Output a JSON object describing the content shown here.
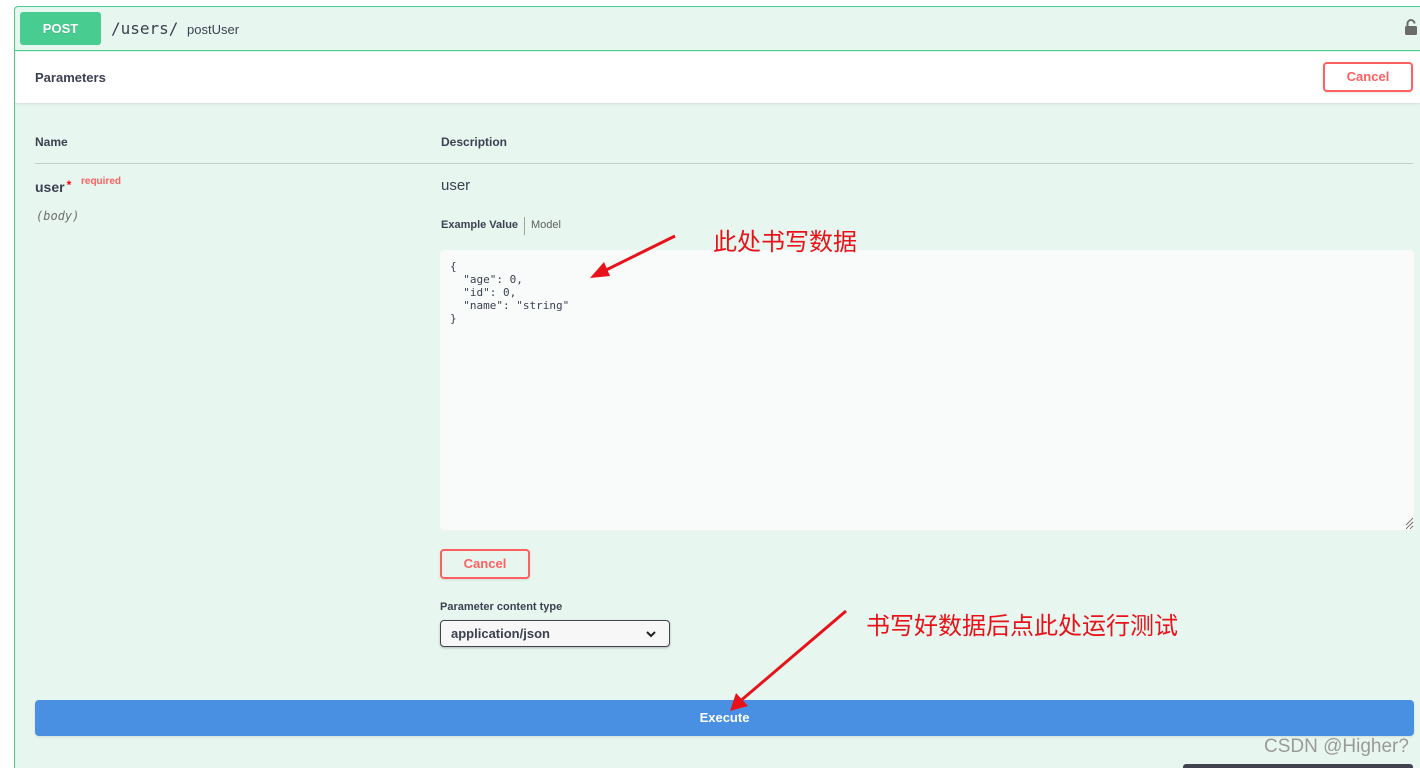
{
  "operation": {
    "method": "POST",
    "path": "/users/",
    "operation_id": "postUser",
    "lock_icon": "lock-icon"
  },
  "parameters": {
    "title": "Parameters",
    "cancel_label": "Cancel",
    "columns": {
      "name": "Name",
      "description": "Description"
    },
    "items": [
      {
        "name": "user",
        "required_star": "*",
        "required_label": "required",
        "in": "(body)",
        "description": "user",
        "tabs": {
          "example": "Example Value",
          "model": "Model"
        },
        "value": "{\n  \"age\": 0,\n  \"id\": 0,\n  \"name\": \"string\"\n}"
      }
    ],
    "inline_cancel_label": "Cancel",
    "content_type_label": "Parameter content type",
    "content_type_selected": "application/json"
  },
  "execute_label": "Execute",
  "annotations": {
    "write_data": "此处书写数据",
    "click_execute": "书写好数据后点此处运行测试",
    "color": "#e8131a"
  },
  "watermark": "CSDN @Higher?",
  "colors": {
    "post_green": "#49cc90",
    "block_bg": "#e8f6f0",
    "cancel_red": "#ff6060",
    "execute_blue": "#4990e2"
  }
}
